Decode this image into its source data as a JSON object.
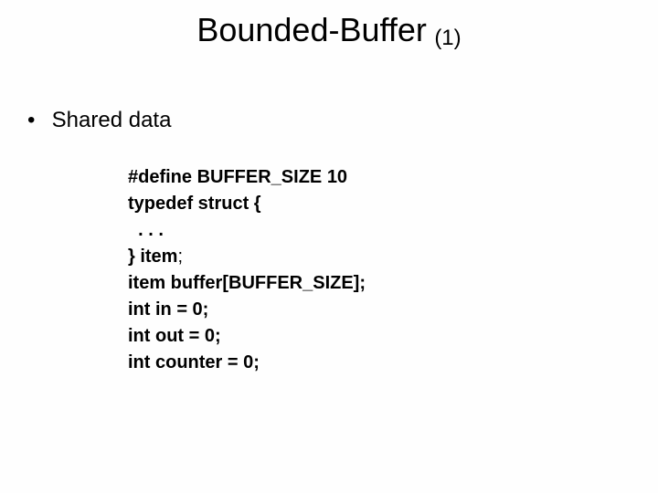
{
  "title": {
    "main": "Bounded-Buffer",
    "sub": "(1)"
  },
  "bullet": {
    "marker": "•",
    "text": "Shared data"
  },
  "code": {
    "l1": "#define BUFFER_SIZE 10",
    "l2": "typedef struct {",
    "l3": "  . . .",
    "l4a": "} item",
    "l4b": ";",
    "l5": "item buffer[BUFFER_SIZE];",
    "l6": "int in = 0;",
    "l7": "int out = 0;",
    "l8": "int counter = 0;"
  }
}
